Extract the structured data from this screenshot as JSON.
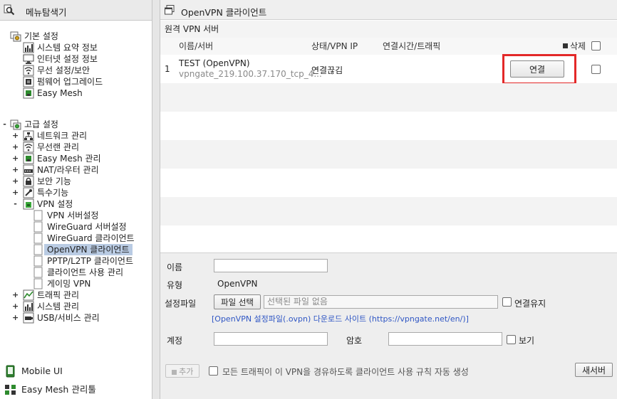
{
  "left_panel": {
    "title": "메뉴탐색기",
    "basic": {
      "label": "기본 설정",
      "items": [
        {
          "label": "시스템 요약 정보",
          "icon": "chart-icon"
        },
        {
          "label": "인터넷 설정 정보",
          "icon": "monitor-icon"
        },
        {
          "label": "무선 설정/보안",
          "icon": "wifi-icon"
        },
        {
          "label": "펌웨어 업그레이드",
          "icon": "firmware-icon"
        },
        {
          "label": "Easy Mesh",
          "icon": "mesh-icon"
        }
      ]
    },
    "advanced": {
      "label": "고급 설정",
      "items": [
        {
          "label": "네트워크 관리",
          "expander": "+"
        },
        {
          "label": "무선랜 관리",
          "expander": "+"
        },
        {
          "label": "Easy Mesh 관리",
          "expander": "+"
        },
        {
          "label": "NAT/라우터 관리",
          "expander": "+"
        },
        {
          "label": "보안 기능",
          "expander": "+"
        },
        {
          "label": "특수기능",
          "expander": "+"
        },
        {
          "label": "VPN 설정",
          "expander": "-"
        }
      ],
      "vpn_children": [
        {
          "label": "VPN 서버설정"
        },
        {
          "label": "WireGuard 서버설정"
        },
        {
          "label": "WireGuard 클라이언트"
        },
        {
          "label": "OpenVPN 클라이언트",
          "selected": true
        },
        {
          "label": "PPTP/L2TP 클라이언트"
        },
        {
          "label": "클라이언트 사용 관리"
        },
        {
          "label": "게이밍 VPN"
        }
      ],
      "after_items": [
        {
          "label": "트래픽 관리",
          "expander": "+"
        },
        {
          "label": "시스템 관리",
          "expander": "+"
        },
        {
          "label": "USB/서비스 관리",
          "expander": "+"
        }
      ],
      "expander_open": "-"
    },
    "bottom": [
      {
        "label": "Mobile UI"
      },
      {
        "label": "Easy Mesh 관리툴"
      }
    ]
  },
  "right_panel": {
    "title": "OpenVPN 클라이언트",
    "section_title": "원격 VPN 서버",
    "columns": {
      "name": "이름/서버",
      "status": "상태/VPN IP",
      "time": "연결시간/트래픽",
      "delete": "삭제"
    },
    "rows": [
      {
        "index": "1",
        "name": "TEST (OpenVPN)",
        "server": "vpngate_219.100.37.170_tcp_4...",
        "status": "연결끊김",
        "connect_label": "연결"
      }
    ],
    "form": {
      "name_label": "이름",
      "name_value": "",
      "type_label": "유형",
      "type_value": "OpenVPN",
      "file_label": "설정파일",
      "file_button": "파일 선택",
      "file_placeholder": "선택된 파일 없음",
      "keep_label": "연결유지",
      "download_link": "[OpenVPN 설정파일(.ovpn) 다운로드 사이트 (https://vpngate.net/en/)]",
      "account_label": "계정",
      "account_value": "",
      "password_label": "암호",
      "password_value": "",
      "show_label": "보기",
      "add_button": "추가",
      "auto_rule_label": "모든 트래픽이 이 VPN을 경유하도록 클라이언트 사용 규칙 자동 생성",
      "refresh_button": "새서버"
    }
  },
  "colors": {
    "selection": "#b9cbe3",
    "highlight": "#e32828",
    "link": "#2f56c4"
  }
}
